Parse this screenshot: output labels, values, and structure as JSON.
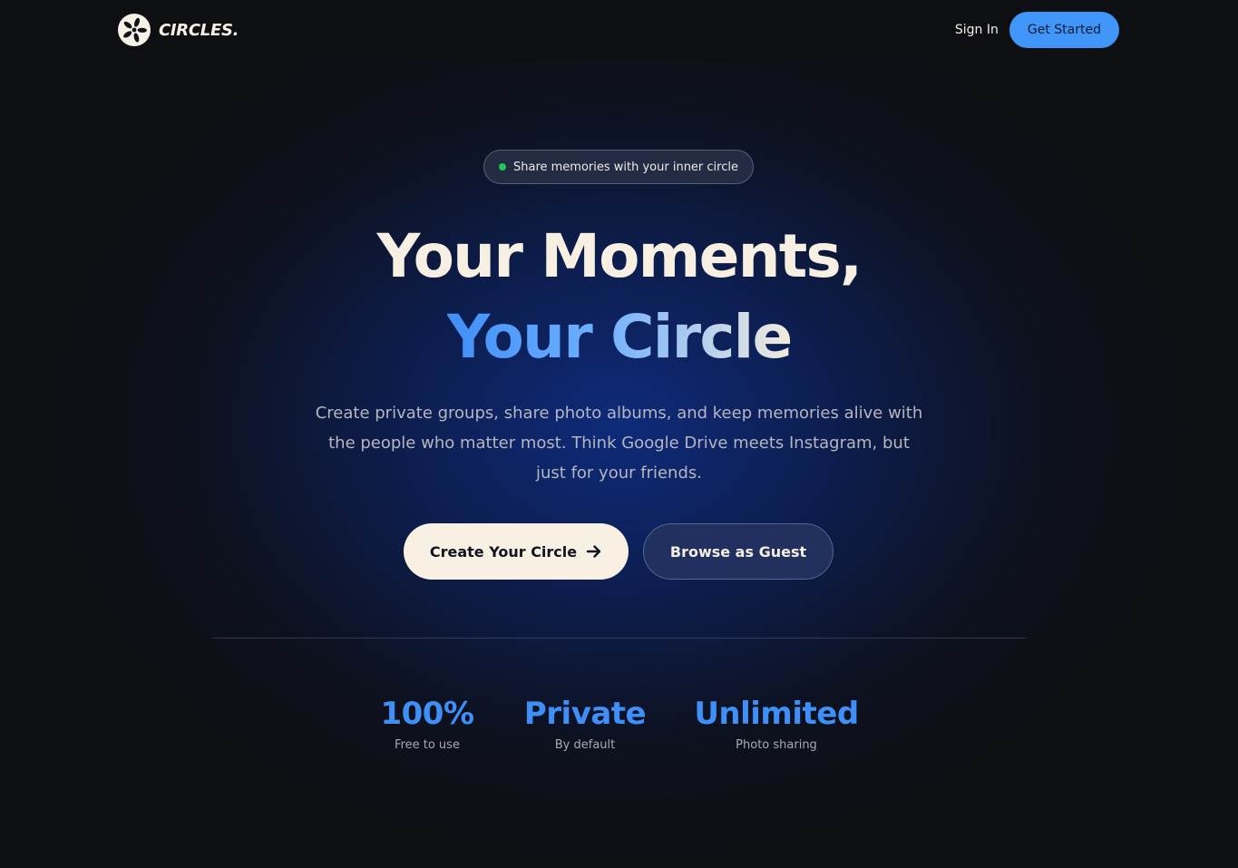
{
  "navbar": {
    "brand": "CIRCLES.",
    "logo_icon": "pinwheel-logo-icon",
    "sign_in_label": "Sign In",
    "get_started_label": "Get Started"
  },
  "hero": {
    "badge_text": "Share memories with your inner circle",
    "title_line1": "Your Moments,",
    "title_line2": "Your Circle",
    "description": "Create private groups, share photo albums, and keep memories alive with the people who matter most. Think Google Drive meets Instagram, but just for your friends.",
    "primary_cta": "Create Your Circle",
    "primary_cta_icon": "arrow-right-icon",
    "secondary_cta": "Browse as Guest"
  },
  "stats": [
    {
      "value": "100%",
      "label": "Free to use"
    },
    {
      "value": "Private",
      "label": "By default"
    },
    {
      "value": "Unlimited",
      "label": "Photo sharing"
    }
  ],
  "colors": {
    "background": "#0e0f13",
    "accent_blue": "#3f8ff7",
    "cream": "#f7f0e2",
    "badge_dot": "#22c55e"
  }
}
